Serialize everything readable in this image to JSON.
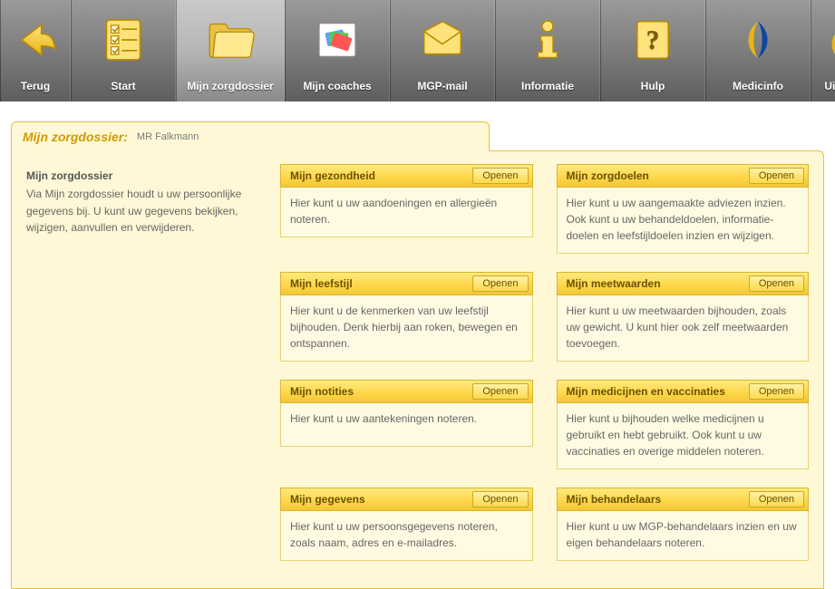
{
  "toolbar": [
    {
      "id": "back",
      "label": "Terug"
    },
    {
      "id": "start",
      "label": "Start"
    },
    {
      "id": "dossier",
      "label": "Mijn zorgdossier"
    },
    {
      "id": "coaches",
      "label": "Mijn coaches"
    },
    {
      "id": "mail",
      "label": "MGP-mail"
    },
    {
      "id": "info",
      "label": "Informatie"
    },
    {
      "id": "help",
      "label": "Hulp"
    },
    {
      "id": "medic",
      "label": "Medicinfo"
    },
    {
      "id": "logout",
      "label": "Uitloggen"
    }
  ],
  "tab": {
    "title": "Mijn zorgdossier:",
    "who": "MR Falkmann"
  },
  "side": {
    "heading": "Mijn zorgdossier",
    "text": "Via Mijn zorgdossier houdt u uw persoonlijke gegevens bij. U kunt uw gegevens bekijken, wijzigen, aanvullen en verwijderen."
  },
  "open_label": "Openen",
  "cards": [
    {
      "title": "Mijn gezondheid",
      "desc": "Hier kunt u uw aandoeningen en allergieën noteren."
    },
    {
      "title": "Mijn zorgdoelen",
      "desc": "Hier kunt u uw aangemaakte adviezen inzien. Ook  kunt u uw behandeldoelen, informatie­doelen en leefstijldoelen inzien en wijzigen."
    },
    {
      "title": "Mijn leefstijl",
      "desc": "Hier kunt u de kenmerken van uw leefstijl bijhouden. Denk hierbij aan roken, bewegen en ontspannen."
    },
    {
      "title": "Mijn meetwaarden",
      "desc": "Hier kunt u uw meetwaarden bijhouden, zoals uw gewicht. U kunt hier ook zelf meetwaarden toevoegen."
    },
    {
      "title": "Mijn notities",
      "desc": "Hier kunt u uw aantekeningen noteren."
    },
    {
      "title": "Mijn medicijnen en vaccinaties",
      "desc": "Hier kunt u bijhouden welke medicijnen u gebruikt en hebt gebruikt. Ook kunt u uw vaccinaties en overige middelen noteren."
    },
    {
      "title": "Mijn gegevens",
      "desc": "Hier kunt u uw persoonsgegevens noteren, zoals naam, adres en e-mailadres."
    },
    {
      "title": "Mijn behandelaars",
      "desc": "Hier kunt u uw MGP-behandelaars inzien en uw eigen behandelaars noteren."
    }
  ]
}
